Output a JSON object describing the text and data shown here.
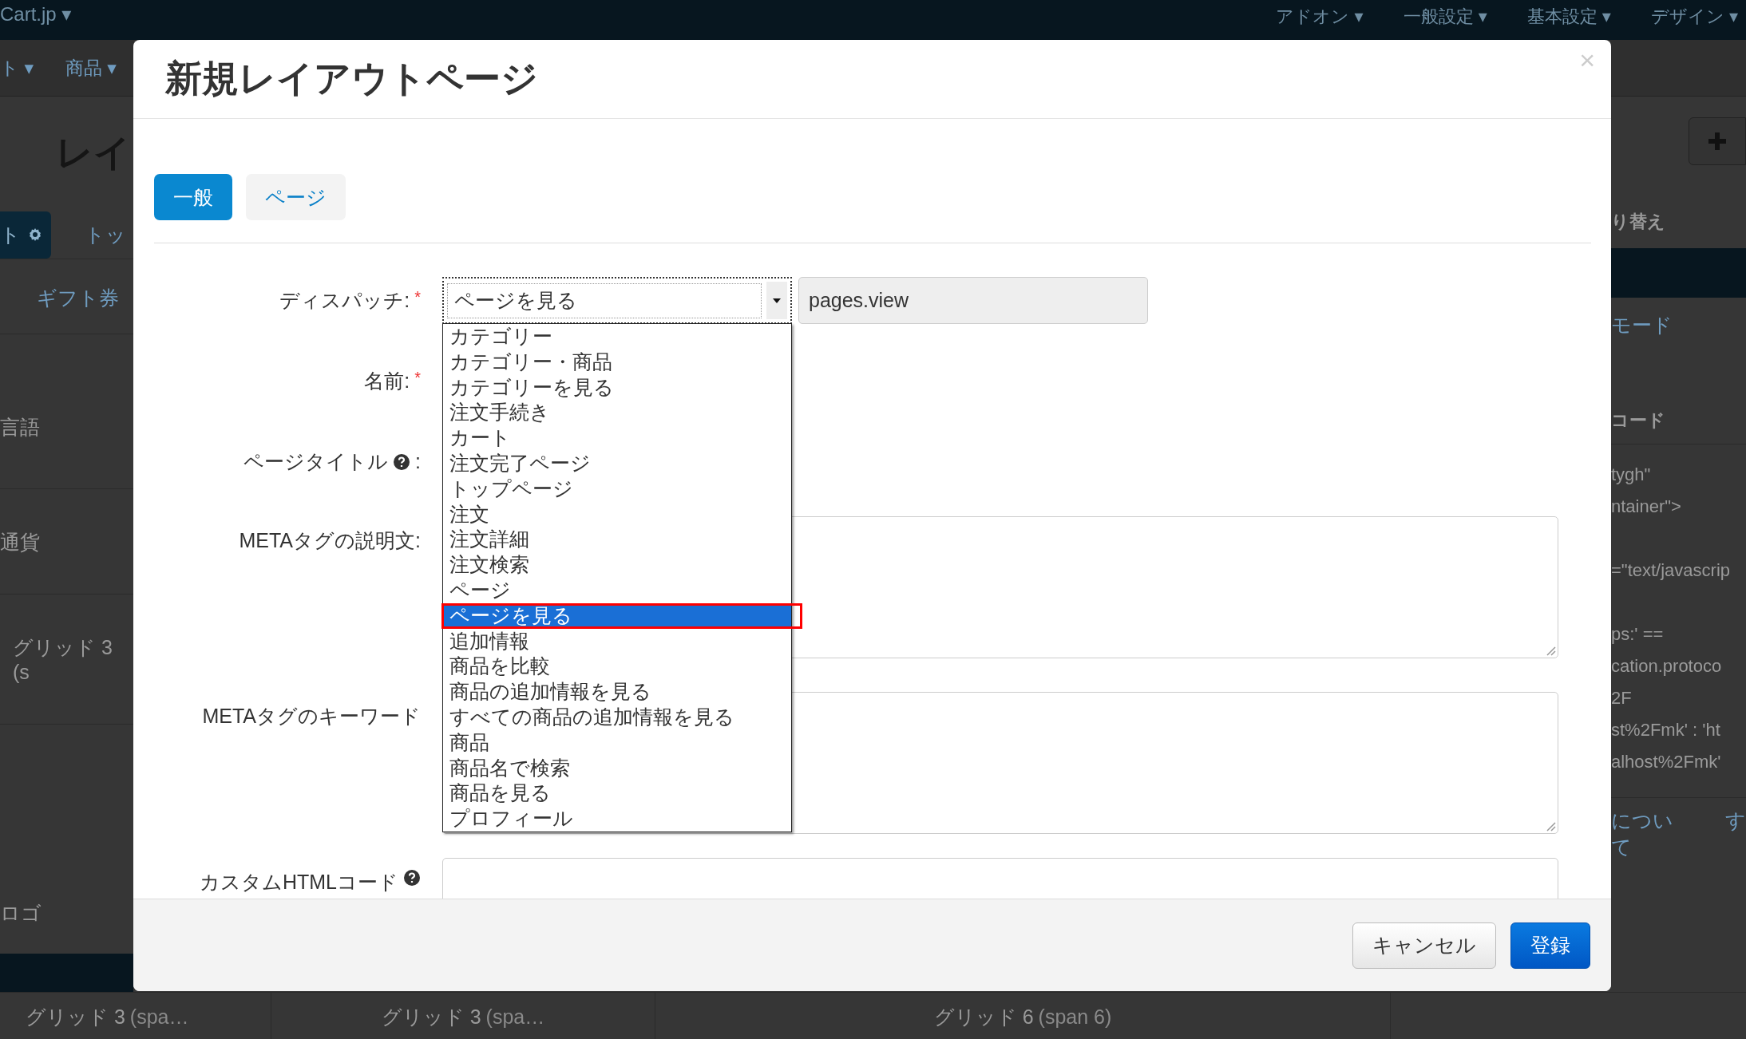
{
  "background": {
    "brand": "Cart.jp ▾",
    "top_menu": [
      "アドオン ▾",
      "一般設定 ▾",
      "基本設定 ▾",
      "デザイン ▾"
    ],
    "second_menu": [
      "ト ▾",
      "商品 ▾"
    ],
    "heading": "レイ",
    "left": {
      "tab": "ト",
      "tab_next": "トッ",
      "items": [
        "ギフト券",
        "言語",
        "通貨",
        "グリッド 3 (s",
        "ロゴ"
      ]
    },
    "right": {
      "switch_label": "り替え",
      "mode_link": "モード",
      "code_label": "コード",
      "code_lines": [
        "tygh\"",
        "ntainer\">",
        "=\"text/javascrip",
        "ps:' ==",
        "cation.protoco",
        "2F",
        "st%2Fmk' : 'ht",
        "alhost%2Fmk'"
      ],
      "links": [
        "について",
        "す"
      ]
    },
    "bottom_row": [
      {
        "name": "グリッド 3",
        "span": "(spa…"
      },
      {
        "name": "グリッド 3",
        "span": "(spa…"
      },
      {
        "name": "グリッド 6",
        "span": "(span 6)"
      }
    ]
  },
  "modal": {
    "title": "新規レイアウトページ",
    "close": "×",
    "required_mark": "*",
    "tabs": [
      {
        "label": "一般",
        "selected": true
      },
      {
        "label": "ページ",
        "selected": false
      }
    ],
    "fields": [
      {
        "kind": "dispatch",
        "label": "ディスパッチ:",
        "required": true,
        "help": false,
        "value": "ページを見る",
        "code": "pages.view",
        "expanded": true
      },
      {
        "kind": "hidden",
        "label": "名前:",
        "required": true,
        "help": false
      },
      {
        "kind": "hidden",
        "label": "ページタイトル",
        "suffix": ":",
        "required": false,
        "help": true
      },
      {
        "kind": "textarea",
        "label": "METAタグの説明文:",
        "required": false,
        "help": false
      },
      {
        "kind": "textarea",
        "label": "METAタグのキーワード",
        "required": false,
        "help": false
      },
      {
        "kind": "cut",
        "label": "カスタムHTMLコード",
        "required": false,
        "help": true
      }
    ],
    "options": [
      {
        "label": "カテゴリー",
        "selected": false
      },
      {
        "label": "カテゴリー・商品",
        "selected": false
      },
      {
        "label": "カテゴリーを見る",
        "selected": false
      },
      {
        "label": "注文手続き",
        "selected": false
      },
      {
        "label": "カート",
        "selected": false
      },
      {
        "label": "注文完了ページ",
        "selected": false
      },
      {
        "label": "トップページ",
        "selected": false
      },
      {
        "label": "注文",
        "selected": false
      },
      {
        "label": "注文詳細",
        "selected": false
      },
      {
        "label": "注文検索",
        "selected": false
      },
      {
        "label": "ページ",
        "selected": false
      },
      {
        "label": "ページを見る",
        "selected": true
      },
      {
        "label": "追加情報",
        "selected": false
      },
      {
        "label": "商品を比較",
        "selected": false
      },
      {
        "label": "商品の追加情報を見る",
        "selected": false
      },
      {
        "label": "すべての商品の追加情報を見る",
        "selected": false
      },
      {
        "label": "商品",
        "selected": false
      },
      {
        "label": "商品名で検索",
        "selected": false
      },
      {
        "label": "商品を見る",
        "selected": false
      },
      {
        "label": "プロフィール",
        "selected": false
      }
    ],
    "buttons": [
      {
        "label": "キャンセル",
        "kind": "secondary"
      },
      {
        "label": "登録",
        "kind": "primary"
      }
    ]
  }
}
